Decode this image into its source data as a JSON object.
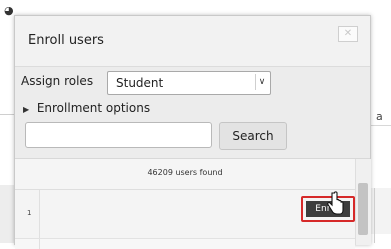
{
  "dialog": {
    "title": "Enroll users",
    "close_glyph": "✕"
  },
  "assign_roles": {
    "label": "Assign roles",
    "selected": "Student",
    "arrow_glyph": "∨"
  },
  "enrollment_options": {
    "triangle_glyph": "▶",
    "label": "Enrollment options"
  },
  "search": {
    "value": "",
    "placeholder": "",
    "button_label": "Search"
  },
  "results": {
    "count_text": "46209 users found",
    "rows": [
      {
        "index": "1",
        "enroll_label": "Enroll"
      }
    ]
  },
  "background": {
    "top_left_glyph": "◕",
    "right_letter": "a"
  },
  "colors": {
    "highlight_border": "#d62929",
    "enroll_button_bg": "#3d3d3d"
  }
}
